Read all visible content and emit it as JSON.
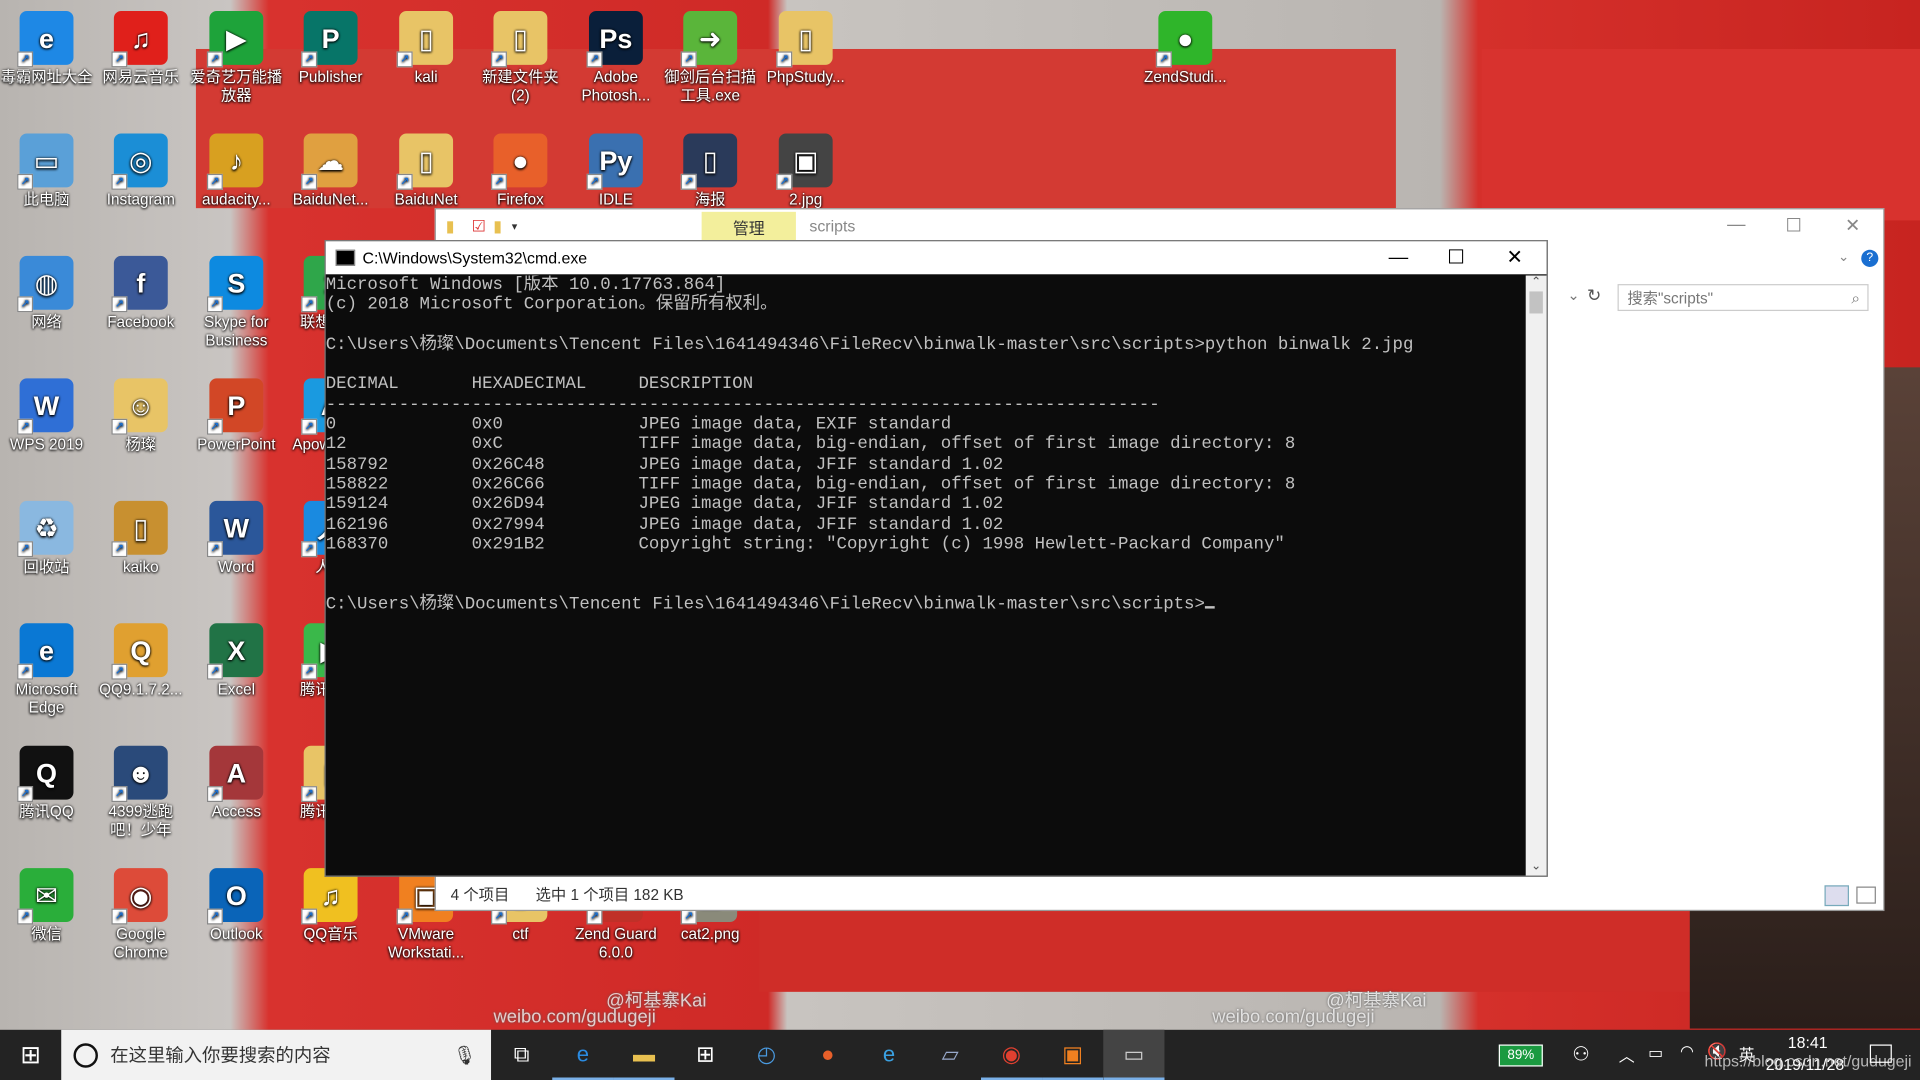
{
  "desktop_icons": [
    {
      "label": "毒霸网址大全",
      "color": "#1e88e5",
      "g": "e",
      "c": 0,
      "r": 0
    },
    {
      "label": "网易云音乐",
      "color": "#e0201b",
      "g": "♫",
      "c": 1,
      "r": 0
    },
    {
      "label": "爱奇艺万能播放器",
      "color": "#1ea33a",
      "g": "▶",
      "c": 2,
      "r": 0
    },
    {
      "label": "Publisher",
      "color": "#077568",
      "g": "P",
      "c": 3,
      "r": 0
    },
    {
      "label": "kali",
      "color": "#e8c466",
      "g": "▯",
      "c": 4,
      "r": 0
    },
    {
      "label": "新建文件夹 (2)",
      "color": "#e8c466",
      "g": "▯",
      "c": 5,
      "r": 0
    },
    {
      "label": "Adobe Photosh...",
      "color": "#0a1f3a",
      "g": "Ps",
      "c": 6,
      "r": 0
    },
    {
      "label": "御剑后台扫描工具.exe",
      "color": "#5ab53a",
      "g": "➜",
      "c": 7,
      "r": 0
    },
    {
      "label": "PhpStudy...",
      "color": "#e8c466",
      "g": "▯",
      "c": 8,
      "r": 0
    },
    {
      "label": "ZendStudi...",
      "color": "#2fb52a",
      "g": "●",
      "c": 12,
      "r": 0
    },
    {
      "label": "此电脑",
      "color": "#5aa0d8",
      "g": "▭",
      "c": 0,
      "r": 1
    },
    {
      "label": "Instagram",
      "color": "#1b8ed6",
      "g": "◎",
      "c": 1,
      "r": 1
    },
    {
      "label": "audacity...",
      "color": "#d8a020",
      "g": "♪",
      "c": 2,
      "r": 1
    },
    {
      "label": "BaiduNet...",
      "color": "#e0a040",
      "g": "☁",
      "c": 3,
      "r": 1
    },
    {
      "label": "BaiduNet",
      "color": "#e8c466",
      "g": "▯",
      "c": 4,
      "r": 1
    },
    {
      "label": "Firefox",
      "color": "#e8602a",
      "g": "●",
      "c": 5,
      "r": 1
    },
    {
      "label": "IDLE (Python...",
      "color": "#3a70b0",
      "g": "Py",
      "c": 6,
      "r": 1
    },
    {
      "label": "海报",
      "color": "#2a3a5a",
      "g": "▯",
      "c": 7,
      "r": 1
    },
    {
      "label": "2.jpg",
      "color": "#444",
      "g": "▣",
      "c": 8,
      "r": 1
    },
    {
      "label": "网络",
      "color": "#3a8ad8",
      "g": "◍",
      "c": 0,
      "r": 2
    },
    {
      "label": "Facebook",
      "color": "#3b5998",
      "g": "f",
      "c": 1,
      "r": 2
    },
    {
      "label": "Skype for Business",
      "color": "#0d8ae0",
      "g": "S",
      "c": 2,
      "r": 2
    },
    {
      "label": "联想软件",
      "color": "#2fa64a",
      "g": "1",
      "c": 3,
      "r": 2
    },
    {
      "label": "WPS 2019",
      "color": "#2f6fd6",
      "g": "W",
      "c": 0,
      "r": 3
    },
    {
      "label": "杨璨",
      "color": "#e8c466",
      "g": "☺",
      "c": 1,
      "r": 3
    },
    {
      "label": "PowerPoint",
      "color": "#d24726",
      "g": "P",
      "c": 2,
      "r": 3
    },
    {
      "label": "Apowersoft",
      "color": "#1a9ae0",
      "g": "A",
      "c": 3,
      "r": 3
    },
    {
      "label": "回收站",
      "color": "#8ab8e0",
      "g": "♻",
      "c": 0,
      "r": 4
    },
    {
      "label": "kaiko",
      "color": "#c89030",
      "g": "▯",
      "c": 1,
      "r": 4
    },
    {
      "label": "Word",
      "color": "#2b579a",
      "g": "W",
      "c": 2,
      "r": 4
    },
    {
      "label": "人人",
      "color": "#1a8ae0",
      "g": "人",
      "c": 3,
      "r": 4
    },
    {
      "label": "Microsoft Edge",
      "color": "#0a78d4",
      "g": "e",
      "c": 0,
      "r": 5
    },
    {
      "label": "QQ9.1.7.2...",
      "color": "#e0a030",
      "g": "Q",
      "c": 1,
      "r": 5
    },
    {
      "label": "Excel",
      "color": "#217346",
      "g": "X",
      "c": 2,
      "r": 5
    },
    {
      "label": "腾讯视频",
      "color": "#3ab84a",
      "g": "▶",
      "c": 3,
      "r": 5
    },
    {
      "label": "腾讯QQ",
      "color": "#111",
      "g": "Q",
      "c": 0,
      "r": 6
    },
    {
      "label": "4399逃跑吧！少年",
      "color": "#2a4a7a",
      "g": "☻",
      "c": 1,
      "r": 6
    },
    {
      "label": "Access",
      "color": "#a4373a",
      "g": "A",
      "c": 2,
      "r": 6
    },
    {
      "label": "腾讯文件",
      "color": "#e8c466",
      "g": "▯",
      "c": 3,
      "r": 6
    },
    {
      "label": "微信",
      "color": "#2aae3a",
      "g": "✉",
      "c": 0,
      "r": 7
    },
    {
      "label": "Google Chrome",
      "color": "#dd4b39",
      "g": "◉",
      "c": 1,
      "r": 7
    },
    {
      "label": "Outlook",
      "color": "#0a64b8",
      "g": "O",
      "c": 2,
      "r": 7
    },
    {
      "label": "QQ音乐",
      "color": "#f0c020",
      "g": "♫",
      "c": 3,
      "r": 7
    },
    {
      "label": "VMware Workstati...",
      "color": "#f08020",
      "g": "▣",
      "c": 4,
      "r": 7
    },
    {
      "label": "ctf",
      "color": "#e8c466",
      "g": "▯",
      "c": 5,
      "r": 7
    },
    {
      "label": "Zend Guard 6.0.0",
      "color": "#c03028",
      "g": "Z",
      "c": 6,
      "r": 7
    },
    {
      "label": "cat2.png",
      "color": "#8a8a7a",
      "g": "▣",
      "c": 7,
      "r": 7
    }
  ],
  "explorer": {
    "manage_tab": "管理",
    "title": "scripts",
    "search_placeholder": "搜索\"scripts\"",
    "status_items": "4 个项目",
    "status_selected": "选中 1 个项目  182 KB"
  },
  "cmd": {
    "title": "C:\\Windows\\System32\\cmd.exe",
    "lines": [
      "Microsoft Windows [版本 10.0.17763.864]",
      "(c) 2018 Microsoft Corporation。保留所有权利。",
      "",
      "C:\\Users\\杨璨\\Documents\\Tencent Files\\1641494346\\FileRecv\\binwalk-master\\src\\scripts>python binwalk 2.jpg",
      "",
      "DECIMAL       HEXADECIMAL     DESCRIPTION",
      "--------------------------------------------------------------------------------",
      "0             0x0             JPEG image data, EXIF standard",
      "12            0xC             TIFF image data, big-endian, offset of first image directory: 8",
      "158792        0x26C48         JPEG image data, JFIF standard 1.02",
      "158822        0x26C66         TIFF image data, big-endian, offset of first image directory: 8",
      "159124        0x26D94         JPEG image data, JFIF standard 1.02",
      "162196        0x27994         JPEG image data, JFIF standard 1.02",
      "168370        0x291B2         Copyright string: \"Copyright (c) 1998 Hewlett-Packard Company\"",
      "",
      "",
      "C:\\Users\\杨璨\\Documents\\Tencent Files\\1641494346\\FileRecv\\binwalk-master\\src\\scripts>"
    ]
  },
  "taskbar": {
    "search_placeholder": "在这里输入你要搜索的内容",
    "battery": "89%",
    "ime": "英",
    "time": "18:41",
    "date": "2019/11/28",
    "apps": [
      "task-view",
      "edge",
      "file-explorer",
      "store",
      "clock",
      "firefox",
      "ie",
      "notes",
      "chrome",
      "shop",
      "cmd"
    ]
  },
  "watermarks": {
    "weibo1": "@柯基寨Kai",
    "weibo2": "weibo.com/gudugeji",
    "csdn": "https://blog.csdn.net/gudugeji"
  }
}
